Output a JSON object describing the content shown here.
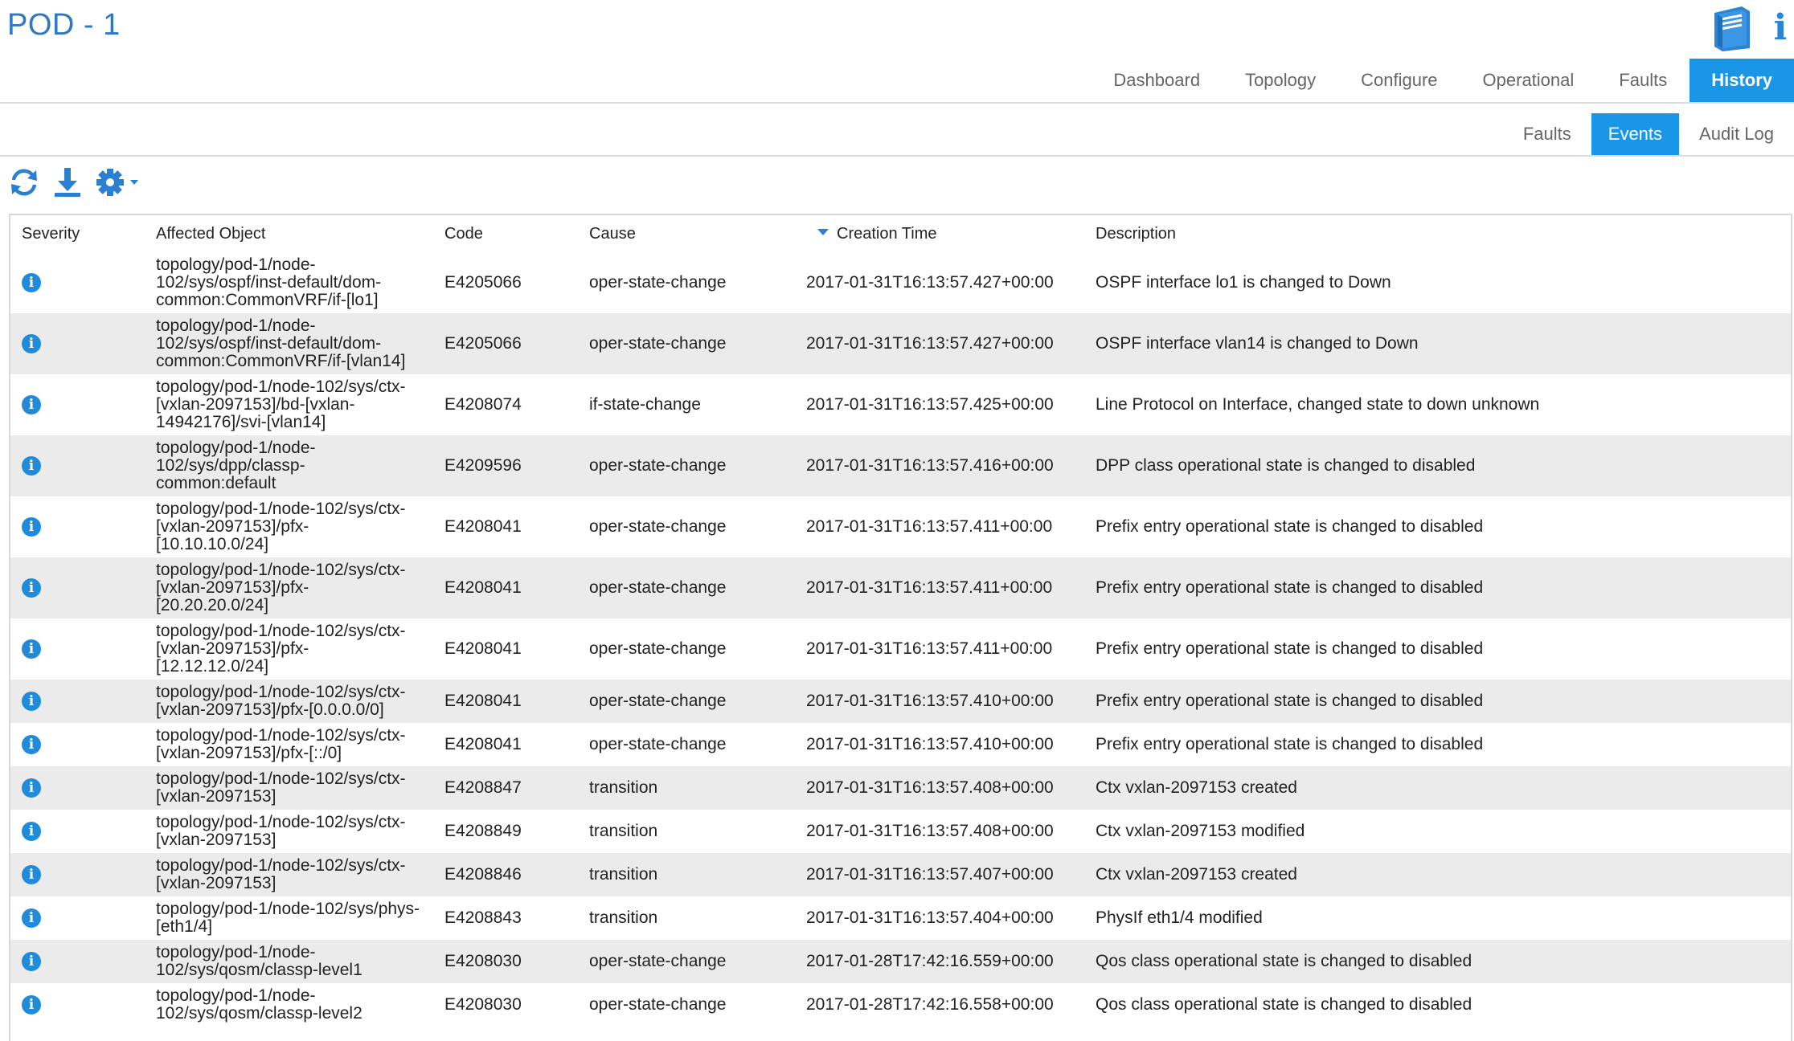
{
  "app": {
    "title": "POD - 1"
  },
  "header_icons": {
    "book": "book-icon",
    "info": "info-icon",
    "info_glyph": "i"
  },
  "main_tabs": [
    "Dashboard",
    "Topology",
    "Configure",
    "Operational",
    "Faults",
    "History"
  ],
  "main_tabs_active": "History",
  "sub_tabs": [
    "Faults",
    "Events",
    "Audit Log"
  ],
  "sub_tabs_active": "Events",
  "toolbar": {
    "refresh": "refresh-icon",
    "download": "download-icon",
    "settings": "gear-icon"
  },
  "table": {
    "columns": [
      "Severity",
      "Affected Object",
      "Code",
      "Cause",
      "Creation Time",
      "Description"
    ],
    "sorted_column": "Creation Time",
    "sort_direction": "descending",
    "severity_icon": "info-icon",
    "rows": [
      {
        "affected": "topology/pod-1/node-\n102/sys/ospf/inst-default/dom-\ncommon:CommonVRF/if-[lo1]",
        "code": "E4205066",
        "cause": "oper-state-change",
        "time": "2017-01-31T16:13:57.427+00:00",
        "description": "OSPF interface lo1 is changed to Down"
      },
      {
        "affected": "topology/pod-1/node-\n102/sys/ospf/inst-default/dom-\ncommon:CommonVRF/if-[vlan14]",
        "code": "E4205066",
        "cause": "oper-state-change",
        "time": "2017-01-31T16:13:57.427+00:00",
        "description": "OSPF interface vlan14 is changed to Down"
      },
      {
        "affected": "topology/pod-1/node-102/sys/ctx-\n[vxlan-2097153]/bd-[vxlan-\n14942176]/svi-[vlan14]",
        "code": "E4208074",
        "cause": "if-state-change",
        "time": "2017-01-31T16:13:57.425+00:00",
        "description": "Line Protocol on Interface, changed state to down unknown"
      },
      {
        "affected": "topology/pod-1/node-\n102/sys/dpp/classp-\ncommon:default",
        "code": "E4209596",
        "cause": "oper-state-change",
        "time": "2017-01-31T16:13:57.416+00:00",
        "description": "DPP class operational state is changed to disabled"
      },
      {
        "affected": "topology/pod-1/node-102/sys/ctx-\n[vxlan-2097153]/pfx-\n[10.10.10.0/24]",
        "code": "E4208041",
        "cause": "oper-state-change",
        "time": "2017-01-31T16:13:57.411+00:00",
        "description": "Prefix entry operational state is changed to disabled"
      },
      {
        "affected": "topology/pod-1/node-102/sys/ctx-\n[vxlan-2097153]/pfx-\n[20.20.20.0/24]",
        "code": "E4208041",
        "cause": "oper-state-change",
        "time": "2017-01-31T16:13:57.411+00:00",
        "description": "Prefix entry operational state is changed to disabled"
      },
      {
        "affected": "topology/pod-1/node-102/sys/ctx-\n[vxlan-2097153]/pfx-\n[12.12.12.0/24]",
        "code": "E4208041",
        "cause": "oper-state-change",
        "time": "2017-01-31T16:13:57.411+00:00",
        "description": "Prefix entry operational state is changed to disabled"
      },
      {
        "affected": "topology/pod-1/node-102/sys/ctx-\n[vxlan-2097153]/pfx-[0.0.0.0/0]",
        "code": "E4208041",
        "cause": "oper-state-change",
        "time": "2017-01-31T16:13:57.410+00:00",
        "description": "Prefix entry operational state is changed to disabled"
      },
      {
        "affected": "topology/pod-1/node-102/sys/ctx-\n[vxlan-2097153]/pfx-[::/0]",
        "code": "E4208041",
        "cause": "oper-state-change",
        "time": "2017-01-31T16:13:57.410+00:00",
        "description": "Prefix entry operational state is changed to disabled"
      },
      {
        "affected": "topology/pod-1/node-102/sys/ctx-\n[vxlan-2097153]",
        "code": "E4208847",
        "cause": "transition",
        "time": "2017-01-31T16:13:57.408+00:00",
        "description": "Ctx vxlan-2097153 created"
      },
      {
        "affected": "topology/pod-1/node-102/sys/ctx-\n[vxlan-2097153]",
        "code": "E4208849",
        "cause": "transition",
        "time": "2017-01-31T16:13:57.408+00:00",
        "description": "Ctx vxlan-2097153 modified"
      },
      {
        "affected": "topology/pod-1/node-102/sys/ctx-\n[vxlan-2097153]",
        "code": "E4208846",
        "cause": "transition",
        "time": "2017-01-31T16:13:57.407+00:00",
        "description": "Ctx vxlan-2097153 created"
      },
      {
        "affected": "topology/pod-1/node-102/sys/phys-\n[eth1/4]",
        "code": "E4208843",
        "cause": "transition",
        "time": "2017-01-31T16:13:57.404+00:00",
        "description": "PhysIf eth1/4 modified"
      },
      {
        "affected": "topology/pod-1/node-\n102/sys/qosm/classp-level1",
        "code": "E4208030",
        "cause": "oper-state-change",
        "time": "2017-01-28T17:42:16.559+00:00",
        "description": "Qos class operational state is changed to disabled"
      },
      {
        "affected": "topology/pod-1/node-\n102/sys/qosm/classp-level2",
        "code": "E4208030",
        "cause": "oper-state-change",
        "time": "2017-01-28T17:42:16.558+00:00",
        "description": "Qos class operational state is changed to disabled"
      }
    ]
  },
  "colors": {
    "accent": "#1a96e6",
    "title": "#2f78c4",
    "row_alt": "#ebebeb"
  }
}
